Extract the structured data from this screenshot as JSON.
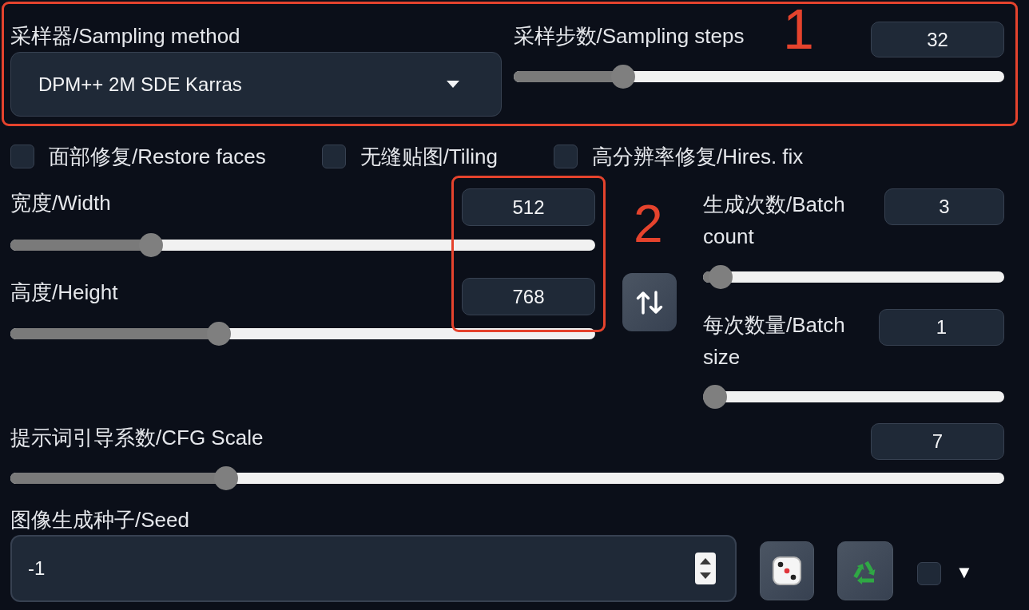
{
  "annotations": [
    {
      "label": "1"
    },
    {
      "label": "2"
    }
  ],
  "sampler": {
    "label": "采样器/Sampling method",
    "value": "DPM++ 2M SDE Karras"
  },
  "sampling_steps": {
    "label": "采样步数/Sampling steps",
    "value": "32",
    "level": 0.21
  },
  "checkboxes": [
    {
      "label": "面部修复/Restore faces",
      "checked": false
    },
    {
      "label": "无缝贴图/Tiling",
      "checked": false
    },
    {
      "label": "高分辨率修复/Hires. fix",
      "checked": false
    }
  ],
  "width": {
    "label": "宽度/Width",
    "value": "512",
    "level": 0.23
  },
  "height": {
    "label": "高度/Height",
    "value": "768",
    "level": 0.35
  },
  "batch_count": {
    "label": "生成次数/Batch count",
    "value": "3",
    "level": 0.02
  },
  "batch_size": {
    "label": "每次数量/Batch size",
    "value": "1",
    "level": 0
  },
  "cfg_scale": {
    "label": "提示词引导系数/CFG Scale",
    "value": "7",
    "level": 0.21
  },
  "seed": {
    "label": "图像生成种子/Seed",
    "value": "-1",
    "extra": {
      "checked": false,
      "toggle": "▼"
    }
  }
}
